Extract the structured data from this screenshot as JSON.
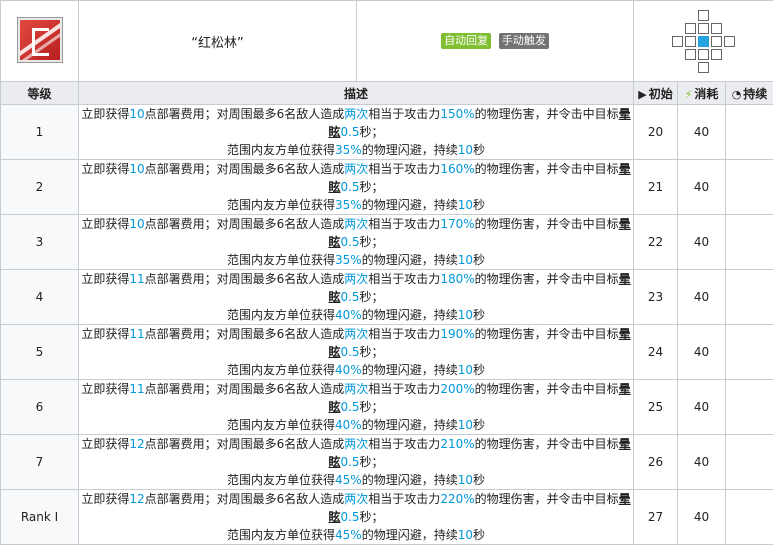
{
  "skill": {
    "name": "“红松林”",
    "tags": [
      "自动回复",
      "手动触发"
    ]
  },
  "headers": {
    "level": "等级",
    "description": "描述",
    "initial": "初始",
    "cost": "消耗",
    "duration": "持续"
  },
  "colors": {
    "highlight": "#0098dc",
    "tag_auto": "#7fbf31",
    "tag_manual": "#737373",
    "range_center": "#27a3e0"
  },
  "rows": [
    {
      "level": "1",
      "a": "10",
      "b": "150%",
      "c": "35%",
      "initial": "20",
      "cost": "40",
      "duration": ""
    },
    {
      "level": "2",
      "a": "10",
      "b": "160%",
      "c": "35%",
      "initial": "21",
      "cost": "40",
      "duration": ""
    },
    {
      "level": "3",
      "a": "10",
      "b": "170%",
      "c": "35%",
      "initial": "22",
      "cost": "40",
      "duration": ""
    },
    {
      "level": "4",
      "a": "11",
      "b": "180%",
      "c": "40%",
      "initial": "23",
      "cost": "40",
      "duration": ""
    },
    {
      "level": "5",
      "a": "11",
      "b": "190%",
      "c": "40%",
      "initial": "24",
      "cost": "40",
      "duration": ""
    },
    {
      "level": "6",
      "a": "11",
      "b": "200%",
      "c": "40%",
      "initial": "25",
      "cost": "40",
      "duration": ""
    },
    {
      "level": "7",
      "a": "12",
      "b": "210%",
      "c": "45%",
      "initial": "26",
      "cost": "40",
      "duration": ""
    },
    {
      "level": "Rank I",
      "a": "12",
      "b": "220%",
      "c": "45%",
      "initial": "27",
      "cost": "40",
      "duration": ""
    }
  ],
  "text": {
    "p1": "立即获得",
    "p2": "点部署费用；对周围最多6名敌人造成",
    "twice": "两次",
    "p3": "相当于攻击力",
    "p4": "的物理伤害，并令击中目标",
    "stun": "晕眩",
    "stun_sec": "0.5",
    "sec": "秒；",
    "l2a": "范围内友方单位获得",
    "l2b": "的物理闪避，持续",
    "dur": "10",
    "l2c": "秒"
  }
}
